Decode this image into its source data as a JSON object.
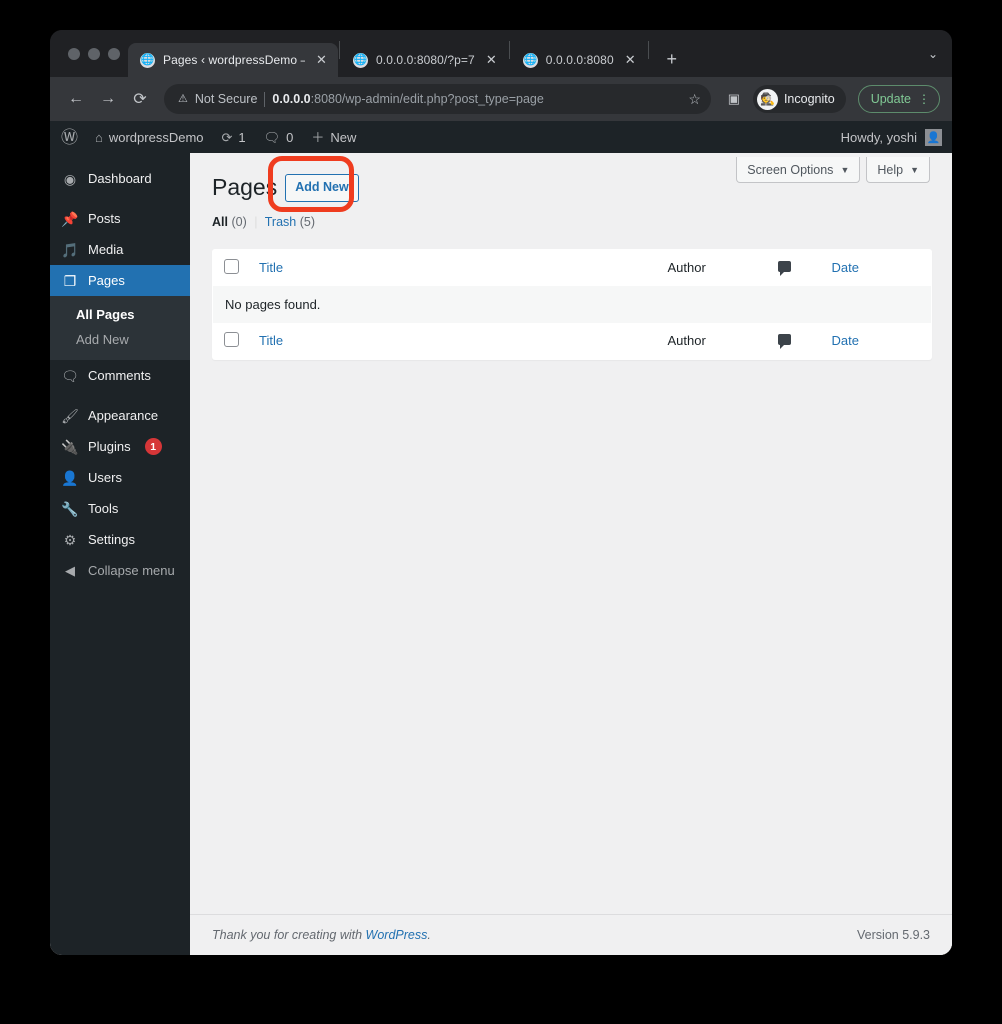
{
  "browser": {
    "traffic_lights": [
      "close",
      "minimize",
      "zoom"
    ],
    "tabs": [
      {
        "title": "Pages ‹ wordpressDemo — Wo",
        "favicon": "globe-icon",
        "active": true,
        "close_label": "✕"
      },
      {
        "title": "0.0.0.0:8080/?p=7",
        "favicon": "globe-icon",
        "active": false,
        "close_label": "✕"
      },
      {
        "title": "0.0.0.0:8080",
        "favicon": "globe-icon",
        "active": false,
        "close_label": "✕"
      }
    ],
    "new_tab_label": "+",
    "tab_list_caret": "⌄",
    "toolbar": {
      "back_label": "←",
      "forward_label": "→",
      "reload_label": "⟳",
      "security_warning": "Not Secure",
      "url_host": "0.0.0.0",
      "url_rest": ":8080/wp-admin/edit.php?post_type=page",
      "bookmark_label": "☆",
      "side_panel_label": "▣",
      "incognito_label": "Incognito",
      "update_label": "Update",
      "menu_label": "⋮"
    }
  },
  "adminbar": {
    "logo": "wordpress-logo",
    "site_name": "wordpressDemo",
    "updates_count": "1",
    "comments_count": "0",
    "new_label": "New",
    "howdy": "Howdy, yoshi"
  },
  "sidebar": {
    "items": [
      {
        "label": "Dashboard",
        "icon": "dashboard-icon",
        "current": false,
        "gap_after": true
      },
      {
        "label": "Posts",
        "icon": "pin-icon",
        "current": false
      },
      {
        "label": "Media",
        "icon": "media-icon",
        "current": false
      },
      {
        "label": "Pages",
        "icon": "pages-icon",
        "current": true
      },
      {
        "label": "Comments",
        "icon": "comment-icon",
        "current": false,
        "gap_after": true
      },
      {
        "label": "Appearance",
        "icon": "brush-icon",
        "current": false
      },
      {
        "label": "Plugins",
        "icon": "plug-icon",
        "current": false,
        "badge": "1"
      },
      {
        "label": "Users",
        "icon": "user-icon",
        "current": false
      },
      {
        "label": "Tools",
        "icon": "wrench-icon",
        "current": false
      },
      {
        "label": "Settings",
        "icon": "settings-icon",
        "current": false
      }
    ],
    "submenu": [
      {
        "label": "All Pages",
        "current": true
      },
      {
        "label": "Add New",
        "current": false
      }
    ],
    "collapse": {
      "label": "Collapse menu",
      "icon": "collapse-icon"
    }
  },
  "main": {
    "screen_options_label": "Screen Options",
    "help_label": "Help",
    "caret": "▼",
    "page_title": "Pages",
    "add_new_label": "Add New",
    "annotation": {
      "type": "highlight-rect",
      "color": "#ef3c1f",
      "target": "add-new-button"
    },
    "filters": {
      "all_label": "All",
      "all_count": "(0)",
      "separator": "|",
      "trash_label": "Trash",
      "trash_count": "(5)"
    },
    "table": {
      "columns": [
        {
          "key": "cb",
          "label": "",
          "type": "checkbox"
        },
        {
          "key": "title",
          "label": "Title",
          "type": "link"
        },
        {
          "key": "author",
          "label": "Author",
          "type": "text"
        },
        {
          "key": "comments",
          "label": "",
          "type": "comment-icon"
        },
        {
          "key": "date",
          "label": "Date",
          "type": "link"
        }
      ],
      "empty_message": "No pages found.",
      "rows": []
    }
  },
  "footer": {
    "thanks_prefix": "Thank you for creating with ",
    "wordpress_link": "WordPress",
    "thanks_suffix": ".",
    "version": "Version 5.9.3"
  }
}
